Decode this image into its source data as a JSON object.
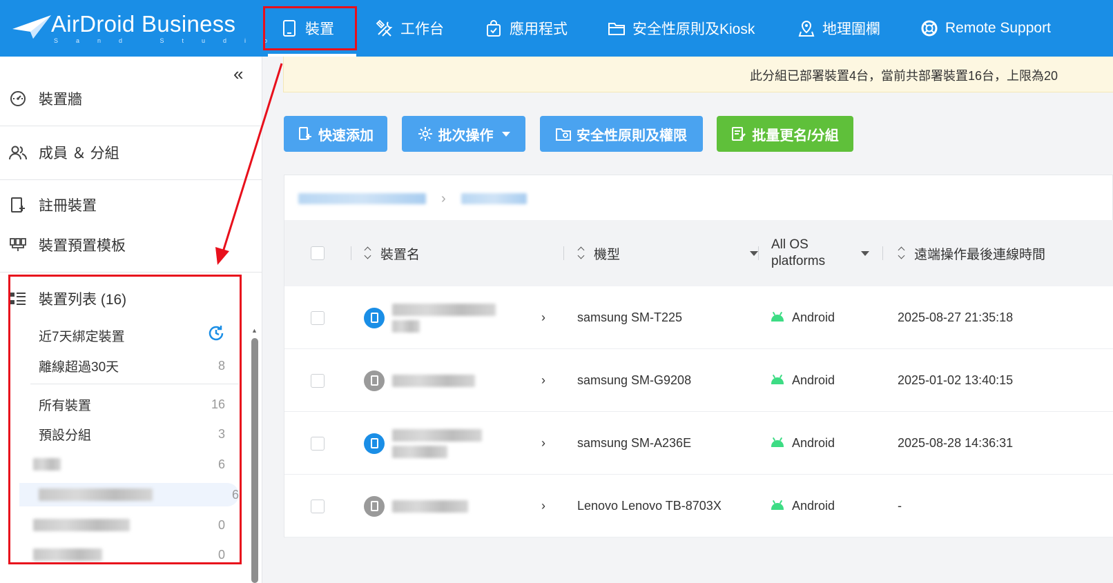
{
  "brand": {
    "name": "AirDroid Business",
    "sub": "Sand Studio"
  },
  "nav": [
    {
      "label": "裝置",
      "icon": "tablet-icon"
    },
    {
      "label": "工作台",
      "icon": "tools-icon"
    },
    {
      "label": "應用程式",
      "icon": "app-bag-icon"
    },
    {
      "label": "安全性原則及Kiosk",
      "icon": "folder-icon"
    },
    {
      "label": "地理圍欄",
      "icon": "geofence-icon"
    },
    {
      "label": "Remote Support",
      "icon": "lifebuoy-icon"
    }
  ],
  "sidebar": {
    "items": [
      {
        "label": "裝置牆",
        "icon": "dashboard-icon"
      },
      {
        "label": "成員 ＆ 分組",
        "icon": "members-icon"
      },
      {
        "label": "註冊裝置",
        "icon": "register-device-icon"
      },
      {
        "label": "裝置預置模板",
        "icon": "template-icon"
      }
    ],
    "list_title": "裝置列表 (16)",
    "groups": [
      {
        "label": "近7天綁定裝置",
        "count": ""
      },
      {
        "label": "離線超過30天",
        "count": "8"
      },
      {
        "label": "所有裝置",
        "count": "16"
      },
      {
        "label": "預設分組",
        "count": "3"
      },
      {
        "label": "",
        "count": "6"
      },
      {
        "label": "",
        "count": "6"
      },
      {
        "label": "",
        "count": "0"
      },
      {
        "label": "",
        "count": "0"
      }
    ]
  },
  "notice": "此分組已部署裝置4台，當前共部署裝置16台，上限為20",
  "toolbar": {
    "quick_add": "快速添加",
    "batch": "批次操作",
    "policy": "安全性原則及權限",
    "rename": "批量更名/分組"
  },
  "table": {
    "headers": {
      "name": "裝置名",
      "model": "機型",
      "os": "All OS platforms",
      "last_remote": "遠端操作最後連線時間"
    },
    "rows": [
      {
        "status": "online",
        "model": "samsung SM-T225",
        "os": "Android",
        "last_remote": "2025-08-27 21:35:18"
      },
      {
        "status": "offline",
        "model": "samsung SM-G9208",
        "os": "Android",
        "last_remote": "2025-01-02 13:40:15"
      },
      {
        "status": "online",
        "model": "samsung SM-A236E",
        "os": "Android",
        "last_remote": "2025-08-28 14:36:31"
      },
      {
        "status": "offline",
        "model": "Lenovo Lenovo TB-8703X",
        "os": "Android",
        "last_remote": "-"
      }
    ]
  },
  "colors": {
    "primary": "#1a8ee6",
    "button_blue": "#4aa3f0",
    "button_green": "#5fc03a",
    "highlight_red": "#e8101c",
    "notice_bg": "#fdf7e1"
  }
}
